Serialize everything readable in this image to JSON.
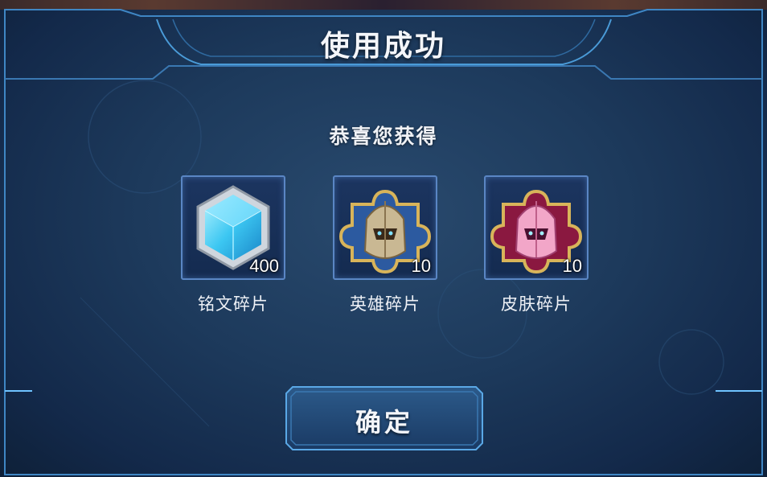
{
  "dialog": {
    "title": "使用成功",
    "subtitle": "恭喜您获得"
  },
  "rewards": [
    {
      "name": "铭文碎片",
      "count": "400",
      "icon": "crystal-hexagon-icon"
    },
    {
      "name": "英雄碎片",
      "count": "10",
      "icon": "gold-helmet-puzzle-icon"
    },
    {
      "name": "皮肤碎片",
      "count": "10",
      "icon": "pink-helmet-puzzle-icon"
    }
  ],
  "confirm_button": {
    "label": "确定"
  },
  "colors": {
    "panel_bg": "#1d3a5c",
    "frame_line": "#4a9bd8",
    "frame_glow": "#6fc3ff",
    "item_border": "#5a86c4",
    "text": "#f4f6fa"
  }
}
